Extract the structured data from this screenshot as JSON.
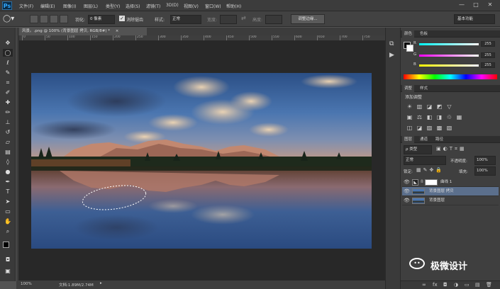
{
  "app": {
    "logo": "Ps"
  },
  "menu": [
    "文件(F)",
    "编辑(E)",
    "图像(I)",
    "图层(L)",
    "类型(Y)",
    "选择(S)",
    "滤镜(T)",
    "3D(D)",
    "视图(V)",
    "窗口(W)",
    "帮助(H)"
  ],
  "window_controls": {
    "minimize": "—",
    "maximize": "□",
    "close": "✕"
  },
  "options": {
    "feather_label": "羽化:",
    "feather_value": "0 像素",
    "antialias_label": "消除锯齿",
    "antialias_checked": true,
    "style_label": "样式:",
    "style_value": "正常",
    "width_label": "宽度:",
    "height_label": "高度:",
    "refine_edge": "调整边缘...",
    "workspace": "基本功能"
  },
  "document": {
    "tab_title": "风景。.png @ 100% (背景图层 拷贝, RGB/8#) *",
    "tab_close": "×",
    "zoom": "100%",
    "doc_size": "文档:1.89M/2.74M"
  },
  "ruler_ticks": [
    "0",
    "50",
    "100",
    "150",
    "200",
    "250",
    "300",
    "350",
    "400",
    "450",
    "500",
    "550",
    "600",
    "650",
    "700",
    "750"
  ],
  "color_panel": {
    "tabs": [
      "颜色",
      "色板"
    ],
    "channels": [
      {
        "label": "R",
        "value": "255"
      },
      {
        "label": "G",
        "value": "255"
      },
      {
        "label": "B",
        "value": "255"
      }
    ]
  },
  "adjustments_panel": {
    "tabs": [
      "调整",
      "样式"
    ],
    "title": "添加调整",
    "icons_row1": [
      "☀",
      "▥",
      "◪",
      "◩",
      "▽"
    ],
    "icons_row2": [
      "▣",
      "⚖",
      "◧",
      "◨",
      "♲",
      "▦"
    ],
    "icons_row3": [
      "◫",
      "◪",
      "▨",
      "▩",
      "▧"
    ]
  },
  "layers_panel": {
    "tabs": [
      "图层",
      "通道",
      "路径"
    ],
    "filter_label": "ρ 类型",
    "blend_mode": "正常",
    "opacity_label": "不透明度:",
    "opacity_value": "100%",
    "lock_label": "锁定:",
    "fill_label": "填充:",
    "fill_value": "100%",
    "layers": [
      {
        "name": "曲线 1",
        "type": "adjustment",
        "selected": false
      },
      {
        "name": "背景图层 拷贝",
        "type": "image",
        "selected": true
      },
      {
        "name": "背景图层",
        "type": "image",
        "selected": false
      }
    ],
    "footer_icons": [
      "∞",
      "fx",
      "◘",
      "◑",
      "▭",
      "▤",
      "🗑"
    ]
  },
  "watermark": {
    "text": "极微设计"
  },
  "colors": {
    "accent_selected": "#5b6f8c",
    "canvas_bg": "#282828"
  }
}
